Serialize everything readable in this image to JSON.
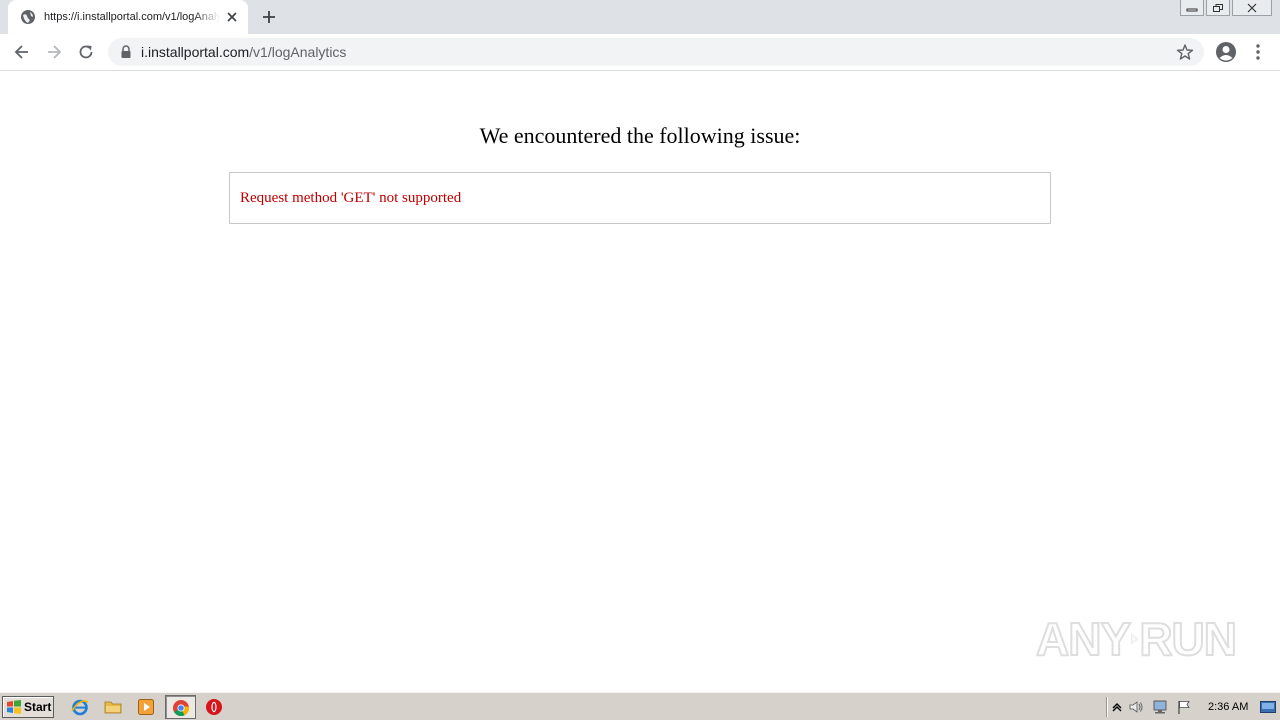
{
  "browser": {
    "tab_title": "https://i.installportal.com/v1/logAnalytics",
    "url_host": "i.installportal.com",
    "url_path": "/v1/logAnalytics"
  },
  "page": {
    "heading": "We encountered the following issue:",
    "error_message": "Request method 'GET' not supported",
    "error_color": "#c00000"
  },
  "watermark": {
    "text_left": "ANY",
    "text_right": "RUN"
  },
  "taskbar": {
    "start_label": "Start",
    "pinned_icons": [
      "internet-explorer-icon",
      "file-explorer-icon",
      "media-player-icon",
      "chrome-icon",
      "opera-icon"
    ],
    "tray_icons": [
      "tray-expand-icon",
      "volume-icon",
      "network-icon",
      "action-center-flag-icon"
    ],
    "clock": "2:36 AM"
  }
}
